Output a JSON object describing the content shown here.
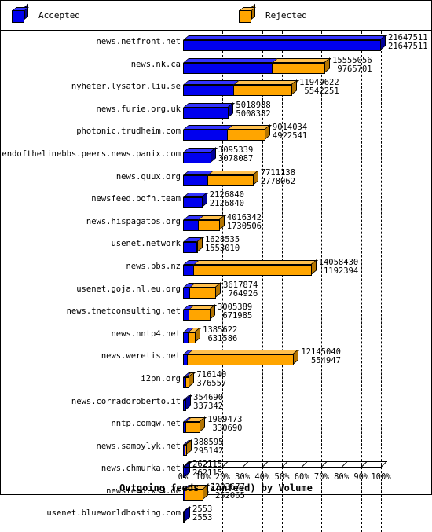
{
  "legend": {
    "items": [
      {
        "label": "Accepted",
        "color": "#0000ee",
        "icon": "cube-icon"
      },
      {
        "label": "Rejected",
        "color": "#ffa500",
        "icon": "cube-icon"
      }
    ]
  },
  "axis": {
    "title": "Outgoing feeds (innfeed) by Volume",
    "ticks": [
      "0%",
      "10%",
      "20%",
      "30%",
      "40%",
      "50%",
      "60%",
      "70%",
      "80%",
      "90%",
      "100%"
    ]
  },
  "chart_data": {
    "type": "bar",
    "orientation": "horizontal",
    "subtype": "stacked-3d-percent",
    "title": "Outgoing feeds (innfeed) by Volume",
    "xlabel": "Outgoing feeds (innfeed) by Volume",
    "ylabel": "",
    "xlim": [
      0,
      100
    ],
    "xtick_labels": [
      "0%",
      "10%",
      "20%",
      "30%",
      "40%",
      "50%",
      "60%",
      "70%",
      "80%",
      "90%",
      "100%"
    ],
    "grid": true,
    "legend_position": "top",
    "scale_max": 21647511,
    "categories": [
      "news.netfront.net",
      "news.nk.ca",
      "nyheter.lysator.liu.se",
      "news.furie.org.uk",
      "photonic.trudheim.com",
      "endofthelinebbs.peers.news.panix.com",
      "news.quux.org",
      "newsfeed.bofh.team",
      "news.hispagatos.org",
      "usenet.network",
      "news.bbs.nz",
      "usenet.goja.nl.eu.org",
      "news.tnetconsulting.net",
      "news.nntp4.net",
      "news.weretis.net",
      "i2pn.org",
      "news.corradoroberto.it",
      "nntp.comgw.net",
      "news.samoylyk.net",
      "news.chmurka.net",
      "newsfeed.xs3.de",
      "usenet.blueworldhosting.com"
    ],
    "series": [
      {
        "name": "Accepted",
        "color": "#0000ee",
        "values": [
          21647511,
          9765701,
          5542251,
          5008382,
          4922541,
          3078087,
          2778062,
          2126840,
          1730506,
          1553010,
          1192394,
          764926,
          671985,
          631586,
          554947,
          376557,
          337342,
          330690,
          295142,
          262115,
          252065,
          2553
        ]
      },
      {
        "name": "Rejected",
        "color": "#ffa500",
        "values": [
          0,
          5789355,
          6407371,
          10606,
          4091493,
          17252,
          4933076,
          0,
          2285836,
          75525,
          12866036,
          2852948,
          2333404,
          754036,
          11590093,
          339583,
          17348,
          1578783,
          93453,
          0,
          1951612,
          0
        ]
      }
    ],
    "totals": [
      21647511,
      15555056,
      11949622,
      5018988,
      9014034,
      3095339,
      7711138,
      2126840,
      4016342,
      1628535,
      14058430,
      3617874,
      3005389,
      1385622,
      12145040,
      716140,
      354690,
      1909473,
      388595,
      262115,
      2203677,
      2553
    ],
    "point_labels": [
      {
        "category": "news.netfront.net",
        "total": "21647511",
        "accepted": "21647511"
      },
      {
        "category": "news.nk.ca",
        "total": "15555056",
        "accepted": "9765701"
      },
      {
        "category": "nyheter.lysator.liu.se",
        "total": "11949622",
        "accepted": "5542251"
      },
      {
        "category": "news.furie.org.uk",
        "total": "5018988",
        "accepted": "5008382"
      },
      {
        "category": "photonic.trudheim.com",
        "total": "9014034",
        "accepted": "4922541"
      },
      {
        "category": "endofthelinebbs.peers.news.panix.com",
        "total": "3095339",
        "accepted": "3078087"
      },
      {
        "category": "news.quux.org",
        "total": "7711138",
        "accepted": "2778062"
      },
      {
        "category": "newsfeed.bofh.team",
        "total": "2126840",
        "accepted": "2126840"
      },
      {
        "category": "news.hispagatos.org",
        "total": "4016342",
        "accepted": "1730506"
      },
      {
        "category": "usenet.network",
        "total": "1628535",
        "accepted": "1553010"
      },
      {
        "category": "news.bbs.nz",
        "total": "14058430",
        "accepted": "1192394"
      },
      {
        "category": "usenet.goja.nl.eu.org",
        "total": "3617874",
        "accepted": "764926"
      },
      {
        "category": "news.tnetconsulting.net",
        "total": "3005389",
        "accepted": "671985"
      },
      {
        "category": "news.nntp4.net",
        "total": "1385622",
        "accepted": "631586"
      },
      {
        "category": "news.weretis.net",
        "total": "12145040",
        "accepted": "554947"
      },
      {
        "category": "i2pn.org",
        "total": "716140",
        "accepted": "376557"
      },
      {
        "category": "news.corradoroberto.it",
        "total": "354690",
        "accepted": "337342"
      },
      {
        "category": "nntp.comgw.net",
        "total": "1909473",
        "accepted": "330690"
      },
      {
        "category": "news.samoylyk.net",
        "total": "388595",
        "accepted": "295142"
      },
      {
        "category": "news.chmurka.net",
        "total": "262115",
        "accepted": "262115"
      },
      {
        "category": "newsfeed.xs3.de",
        "total": "2203677",
        "accepted": "252065"
      },
      {
        "category": "usenet.blueworldhosting.com",
        "total": "2553",
        "accepted": "2553"
      }
    ]
  }
}
